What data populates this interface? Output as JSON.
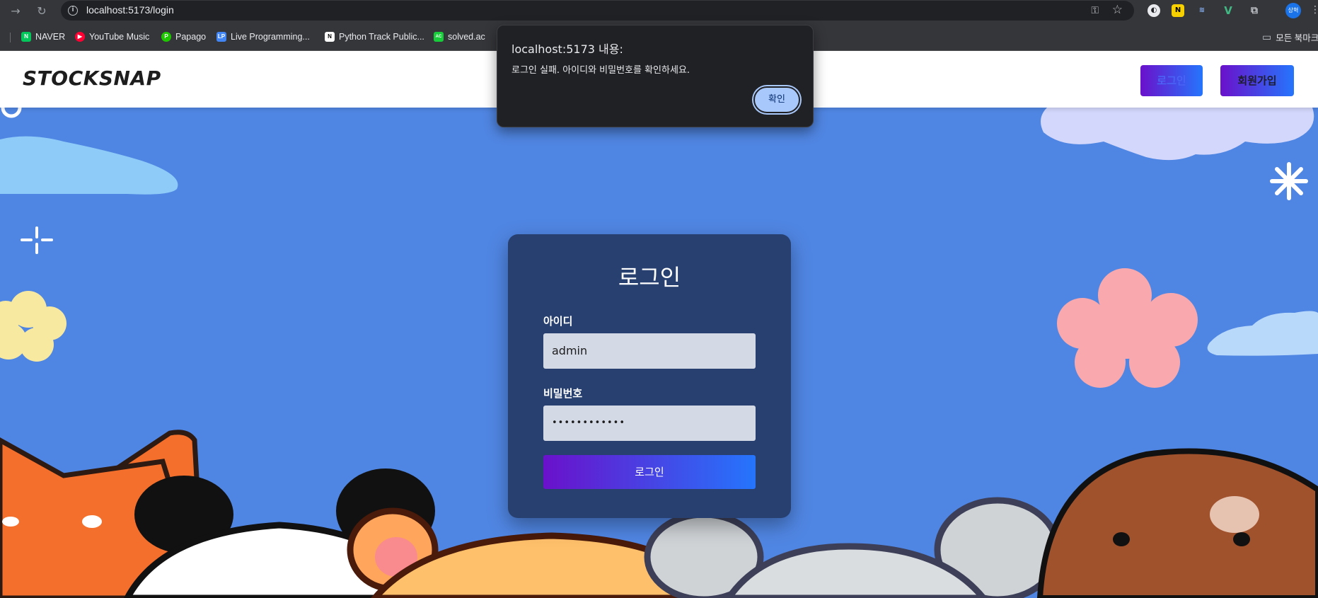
{
  "browser": {
    "url": "localhost:5173/login",
    "bookmarks": [
      {
        "label": "NAVER",
        "icon": "naver-icon",
        "color": "#03c75a"
      },
      {
        "label": "YouTube Music",
        "icon": "youtube-music-icon",
        "color": "#ff0033"
      },
      {
        "label": "Papago",
        "icon": "papago-icon",
        "color": "#1ec800"
      },
      {
        "label": "Live Programming...",
        "icon": "live-programming-icon",
        "color": "#4285f4"
      },
      {
        "label": "Python Track Public...",
        "icon": "notion-icon",
        "color": "#ffffff"
      },
      {
        "label": "solved.ac",
        "icon": "solved-ac-icon",
        "color": "#17ce3a"
      }
    ],
    "all_bookmarks": "모든 북마크",
    "profile_initials": "상혁"
  },
  "header": {
    "logo": "STOCKSNAP",
    "login_button": "로그인",
    "signup_button": "회원가입"
  },
  "login_form": {
    "title": "로그인",
    "id_label": "아이디",
    "id_value": "admin",
    "password_label": "비밀번호",
    "password_value": "••••••••••••",
    "submit_label": "로그인"
  },
  "dialog": {
    "origin": "localhost:5173 내용:",
    "message": "로그인 실패. 아이디와 비밀번호를 확인하세요.",
    "ok_label": "확인"
  },
  "colors": {
    "page_background": "#5086e3",
    "card_background": "#27406f",
    "button_gradient_start": "#6a11cb",
    "button_gradient_end": "#2575fc",
    "dialog_button": "#a8c7fa"
  }
}
